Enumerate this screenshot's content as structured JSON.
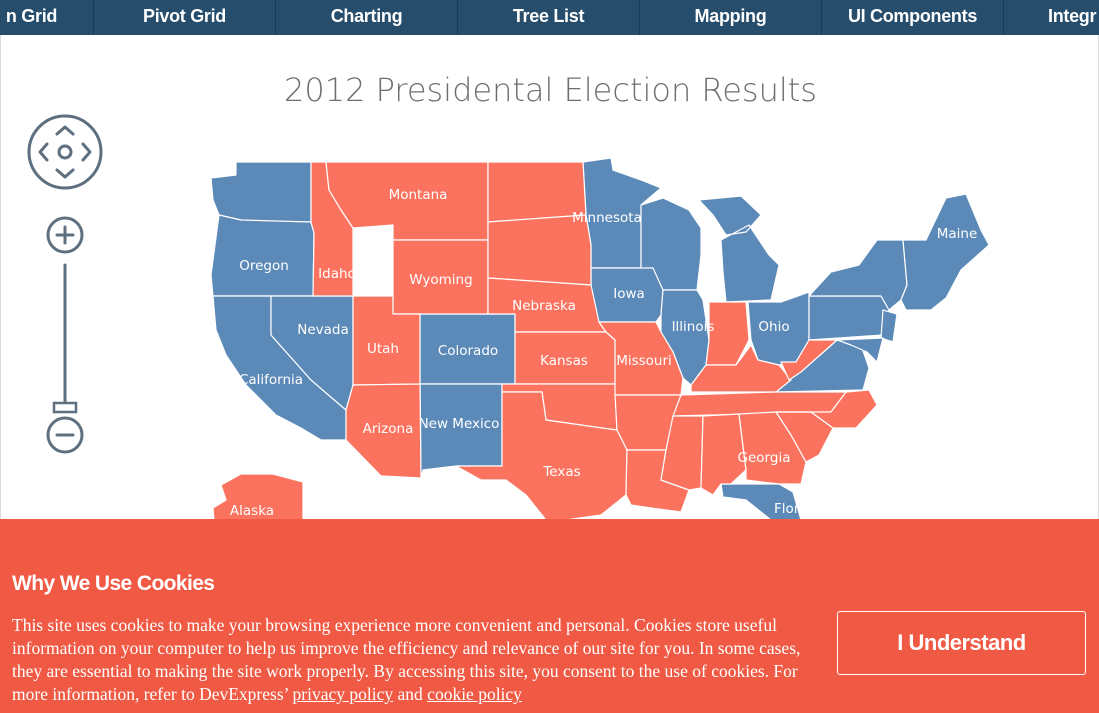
{
  "nav": {
    "items": [
      "n Grid",
      "Pivot Grid",
      "Charting",
      "Tree List",
      "Mapping",
      "UI Components",
      "Integr"
    ]
  },
  "map": {
    "title": "2012 Presidental Election Results",
    "colors": {
      "democratic": "#5b89b8",
      "republican": "#fb735f",
      "border": "#ffffff"
    },
    "state_labels": [
      "Montana",
      "Minnesota",
      "Maine",
      "Oregon",
      "Idaho",
      "Wyoming",
      "Nebraska",
      "Iowa",
      "Illinois",
      "Ohio",
      "Nevada",
      "Utah",
      "Colorado",
      "Kansas",
      "Missouri",
      "California",
      "Arizona",
      "New Mexico",
      "Texas",
      "Georgia",
      "Florida",
      "Alaska"
    ],
    "controls": {
      "pan": "pan-control",
      "zoom_in": "+",
      "zoom_out": "−"
    }
  },
  "cookie": {
    "title": "Why We Use Cookies",
    "body": "This site uses cookies to make your browsing experience more convenient and personal. Cookies store useful information on your computer to help us improve the efficiency and relevance of our site for you. In some cases, they are essential to making the site work properly. By accessing this site, you consent to the use of cookies. For more information, refer to DevExpress’",
    "link_privacy": "privacy policy",
    "and": "and",
    "link_cookie": "cookie policy",
    "button": "I Understand"
  }
}
